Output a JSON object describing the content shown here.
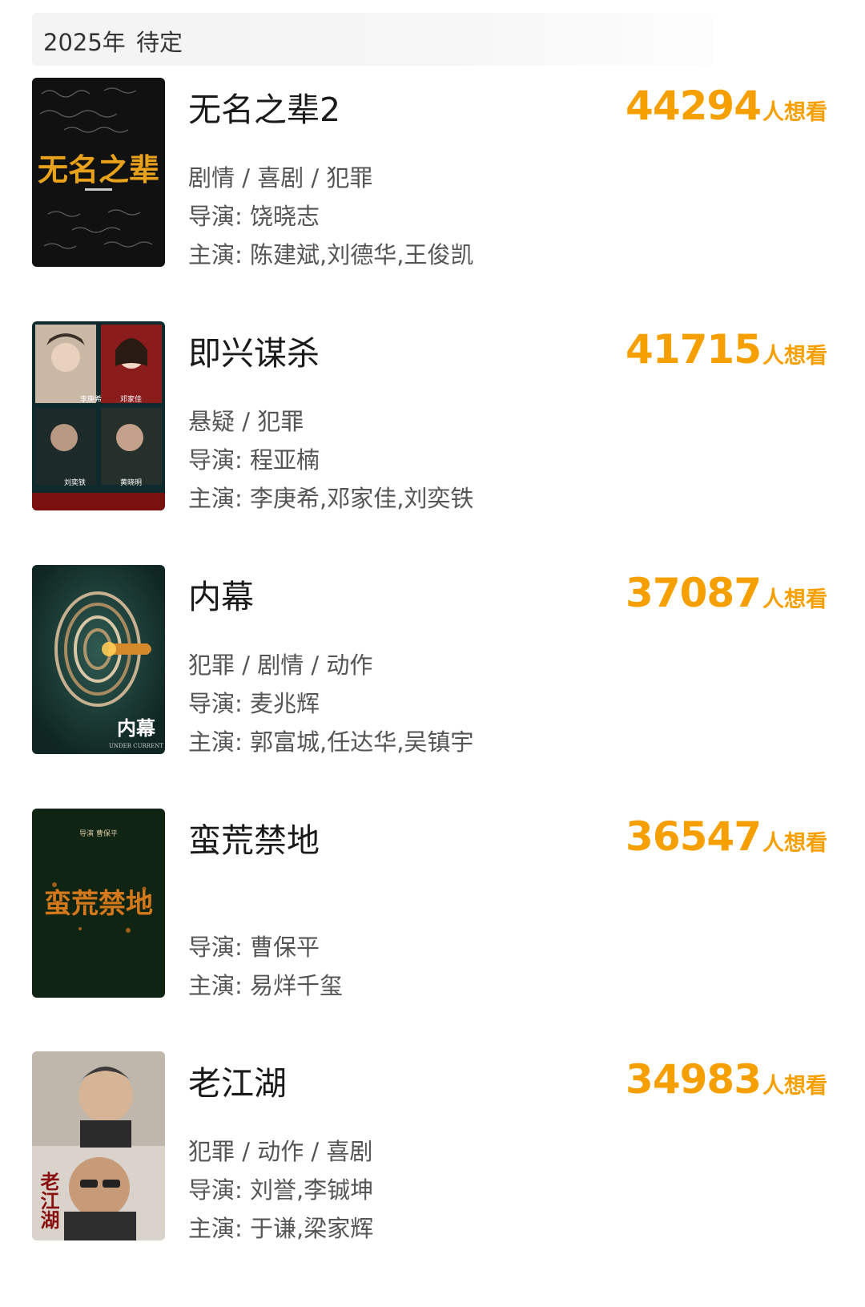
{
  "header": {
    "year": "2025年",
    "status": "待定"
  },
  "want_unit": "人想看",
  "movies": [
    {
      "title": "无名之辈2",
      "want_count": "44294",
      "genres": "剧情 / 喜剧 / 犯罪",
      "director": "导演: 饶晓志",
      "cast": "主演: 陈建斌,刘德华,王俊凯",
      "poster_text": "无名之辈"
    },
    {
      "title": "即兴谋杀",
      "want_count": "41715",
      "genres": "悬疑 / 犯罪",
      "director": "导演: 程亚楠",
      "cast": "主演: 李庚希,邓家佳,刘奕铁",
      "poster_labels": [
        "李庚希",
        "邓家佳",
        "刘奕铁",
        "黄晓明"
      ]
    },
    {
      "title": "内幕",
      "want_count": "37087",
      "genres": "犯罪 / 剧情 / 动作",
      "director": "导演: 麦兆辉",
      "cast": "主演: 郭富城,任达华,吴镇宇",
      "poster_text": "内幕",
      "poster_subtext": "UNDER CURRENT"
    },
    {
      "title": "蛮荒禁地",
      "want_count": "36547",
      "genres": "",
      "director": "导演: 曹保平",
      "cast": "主演: 易烊千玺",
      "poster_text": "蛮荒禁地",
      "poster_top": "导演 曹保平"
    },
    {
      "title": "老江湖",
      "want_count": "34983",
      "genres": "犯罪 / 动作 / 喜剧",
      "director": "导演: 刘誉,李铖坤",
      "cast": "主演: 于谦,梁家辉",
      "poster_text": "老江湖"
    }
  ],
  "colors": {
    "accent": "#f5a000"
  }
}
